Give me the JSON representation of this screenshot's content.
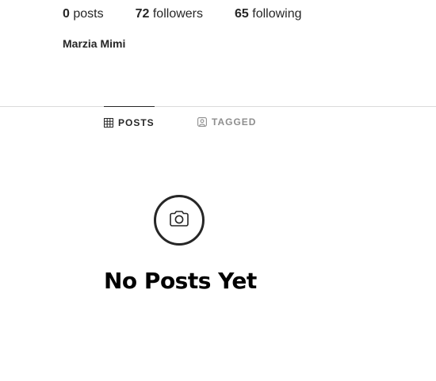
{
  "profile": {
    "stats": {
      "posts_count": "0",
      "posts_label": "posts",
      "followers_count": "72",
      "followers_label": "followers",
      "following_count": "65",
      "following_label": "following"
    },
    "full_name": "Marzia Mimi"
  },
  "tabs": [
    {
      "label": "POSTS",
      "icon": "grid-icon",
      "active": true
    },
    {
      "label": "TAGGED",
      "icon": "tagged-user-icon",
      "active": false
    }
  ],
  "empty_state": {
    "icon": "camera-icon",
    "title": "No Posts Yet"
  },
  "colors": {
    "text": "#262626",
    "muted": "#8e8e8e",
    "divider": "#dbdbdb"
  }
}
